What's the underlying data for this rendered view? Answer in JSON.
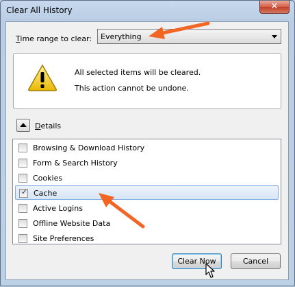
{
  "window": {
    "title": "Clear All History",
    "close_glyph": "✕"
  },
  "time_range": {
    "label_underlined": "T",
    "label_rest": "ime range to clear:",
    "selected": "Everything"
  },
  "warning": {
    "icon": "warning-triangle-icon",
    "line1": "All selected items will be cleared.",
    "line2": "This action cannot be undone."
  },
  "details": {
    "label_underlined": "D",
    "label_rest": "etails",
    "expanded": true
  },
  "items": [
    {
      "label": "Browsing & Download History",
      "checked": false
    },
    {
      "label": "Form & Search History",
      "checked": false
    },
    {
      "label": "Cookies",
      "checked": false
    },
    {
      "label": "Cache",
      "checked": true
    },
    {
      "label": "Active Logins",
      "checked": false
    },
    {
      "label": "Offline Website Data",
      "checked": false
    },
    {
      "label": "Site Preferences",
      "checked": false
    }
  ],
  "check_glyph": "✓",
  "buttons": {
    "clear_now": "Clear Now",
    "cancel": "Cancel"
  },
  "colors": {
    "annotation_arrow": "#f26522",
    "selection_border": "#84acdd"
  }
}
